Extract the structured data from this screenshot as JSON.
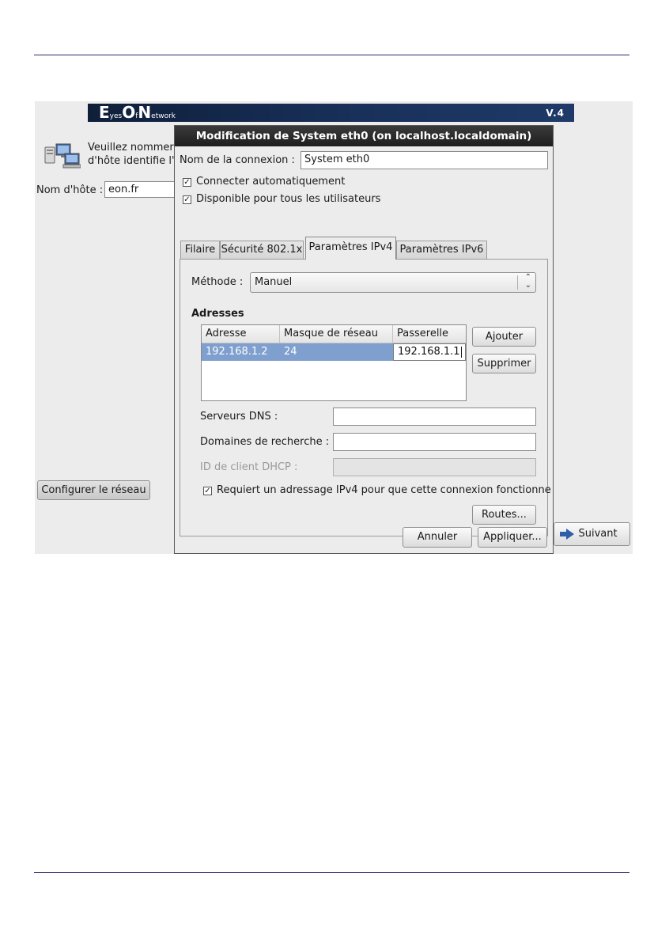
{
  "banner": {
    "logo_e": "E",
    "logo_yes": "yes",
    "logo_o": "O",
    "logo_f": "f",
    "logo_n": "N",
    "logo_etwork": "etwork",
    "version": "V.4"
  },
  "background": {
    "prompt_line1": "Veuillez nommer",
    "prompt_line2": "d'hôte identifie l'c",
    "hostname_label": "Nom d'hôte :",
    "hostname_value": "eon.fr",
    "configure_network": "Configurer le réseau",
    "next_button": "Suivant"
  },
  "dialog": {
    "title": "Modification de System eth0 (on localhost.localdomain)",
    "connection_name_label": "Nom de la connexion :",
    "connection_name_value": "System eth0",
    "auto_connect_label": "Connecter automatiquement",
    "auto_connect_checked": true,
    "all_users_label": "Disponible pour tous les utilisateurs",
    "all_users_checked": true,
    "tabs": [
      "Filaire",
      "Sécurité 802.1x",
      "Paramètres IPv4",
      "Paramètres IPv6"
    ],
    "active_tab": "Paramètres IPv4",
    "ipv4": {
      "method_label": "Méthode :",
      "method_value": "Manuel",
      "addresses_heading": "Adresses",
      "columns": [
        "Adresse",
        "Masque de réseau",
        "Passerelle"
      ],
      "rows": [
        {
          "address": "192.168.1.2",
          "netmask": "24",
          "gateway": "192.168.1.1"
        }
      ],
      "add_button": "Ajouter",
      "remove_button": "Supprimer",
      "dns_label": "Serveurs DNS :",
      "dns_value": "",
      "search_domains_label": "Domaines de recherche :",
      "search_domains_value": "",
      "dhcp_client_id_label": "ID de client DHCP :",
      "dhcp_client_id_value": "",
      "require_ipv4_label": "Requiert un adressage IPv4 pour que cette connexion fonctionne",
      "require_ipv4_checked": true,
      "routes_button": "Routes..."
    },
    "cancel_button": "Annuler",
    "apply_button": "Appliquer..."
  },
  "colors": {
    "banner": "#18305a",
    "titlebar": "#2a2a2a",
    "selection": "#7f9fcf",
    "page_rule": "#2a2a6a"
  }
}
